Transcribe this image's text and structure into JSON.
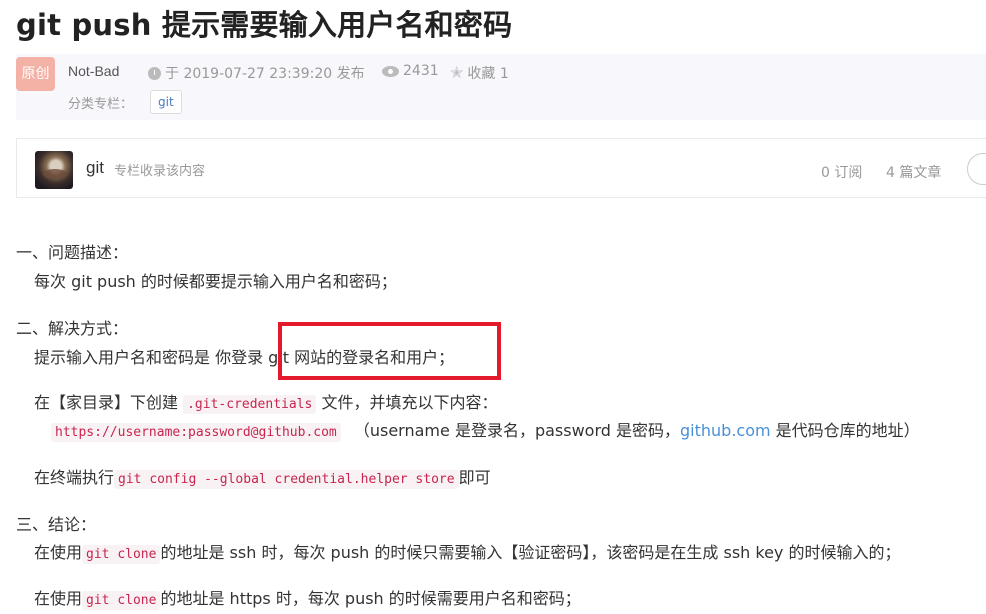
{
  "article": {
    "title": "git push 提示需要输入用户名和密码"
  },
  "meta": {
    "badge": "原创",
    "author": "Not-Bad",
    "published": "于 2019-07-27 23:39:20 发布",
    "views": "2431",
    "favorites": "收藏 1",
    "category_label": "分类专栏：",
    "category_tag": "git",
    "icons": [
      "clock-icon",
      "eye-icon",
      "star-icon"
    ]
  },
  "column": {
    "name": "git",
    "desc": "专栏收录该内容",
    "subs": "0 订阅",
    "articles": "4 篇文章"
  },
  "content": {
    "s1_title": "一、问题描述：",
    "s1_text": "每次 git push 的时候都要提示输入用户名和密码；",
    "s2_title": "二、解决方式：",
    "s2_line1": "提示输入用户名和密码是 你登录 git 网站的登录名和用户；",
    "s2_line2_pre": "在【家目录】下创建",
    "s2_line2_code": ".git-credentials",
    "s2_line2_post": "文件，并填充以下内容：",
    "s2_line3_code": "https://username:password@github.com",
    "s2_line3_pre": "（username 是登录名，password 是密码，",
    "s2_line3_link": "github.com",
    "s2_line3_post": "是代码仓库的地址）",
    "s2_line4_pre": "在终端执行",
    "s2_line4_code": "git config --global credential.helper store",
    "s2_line4_post": "即可",
    "s3_title": "三、结论：",
    "s3_line1_pre": "在使用",
    "s3_line1_code": "git clone",
    "s3_line1_post": "的地址是 ssh 时，每次 push 的时候只需要输入【验证密码】，该密码是在生成 ssh key 的时候输入的；",
    "s3_line2_pre": "在使用",
    "s3_line2_code": "git clone",
    "s3_line2_post": "的地址是 https 时，每次 push 的时候需要用户名和密码；"
  },
  "colors": {
    "highlight_box": "#e5192c",
    "code_text": "#c7254e",
    "link": "#4a90d9"
  }
}
